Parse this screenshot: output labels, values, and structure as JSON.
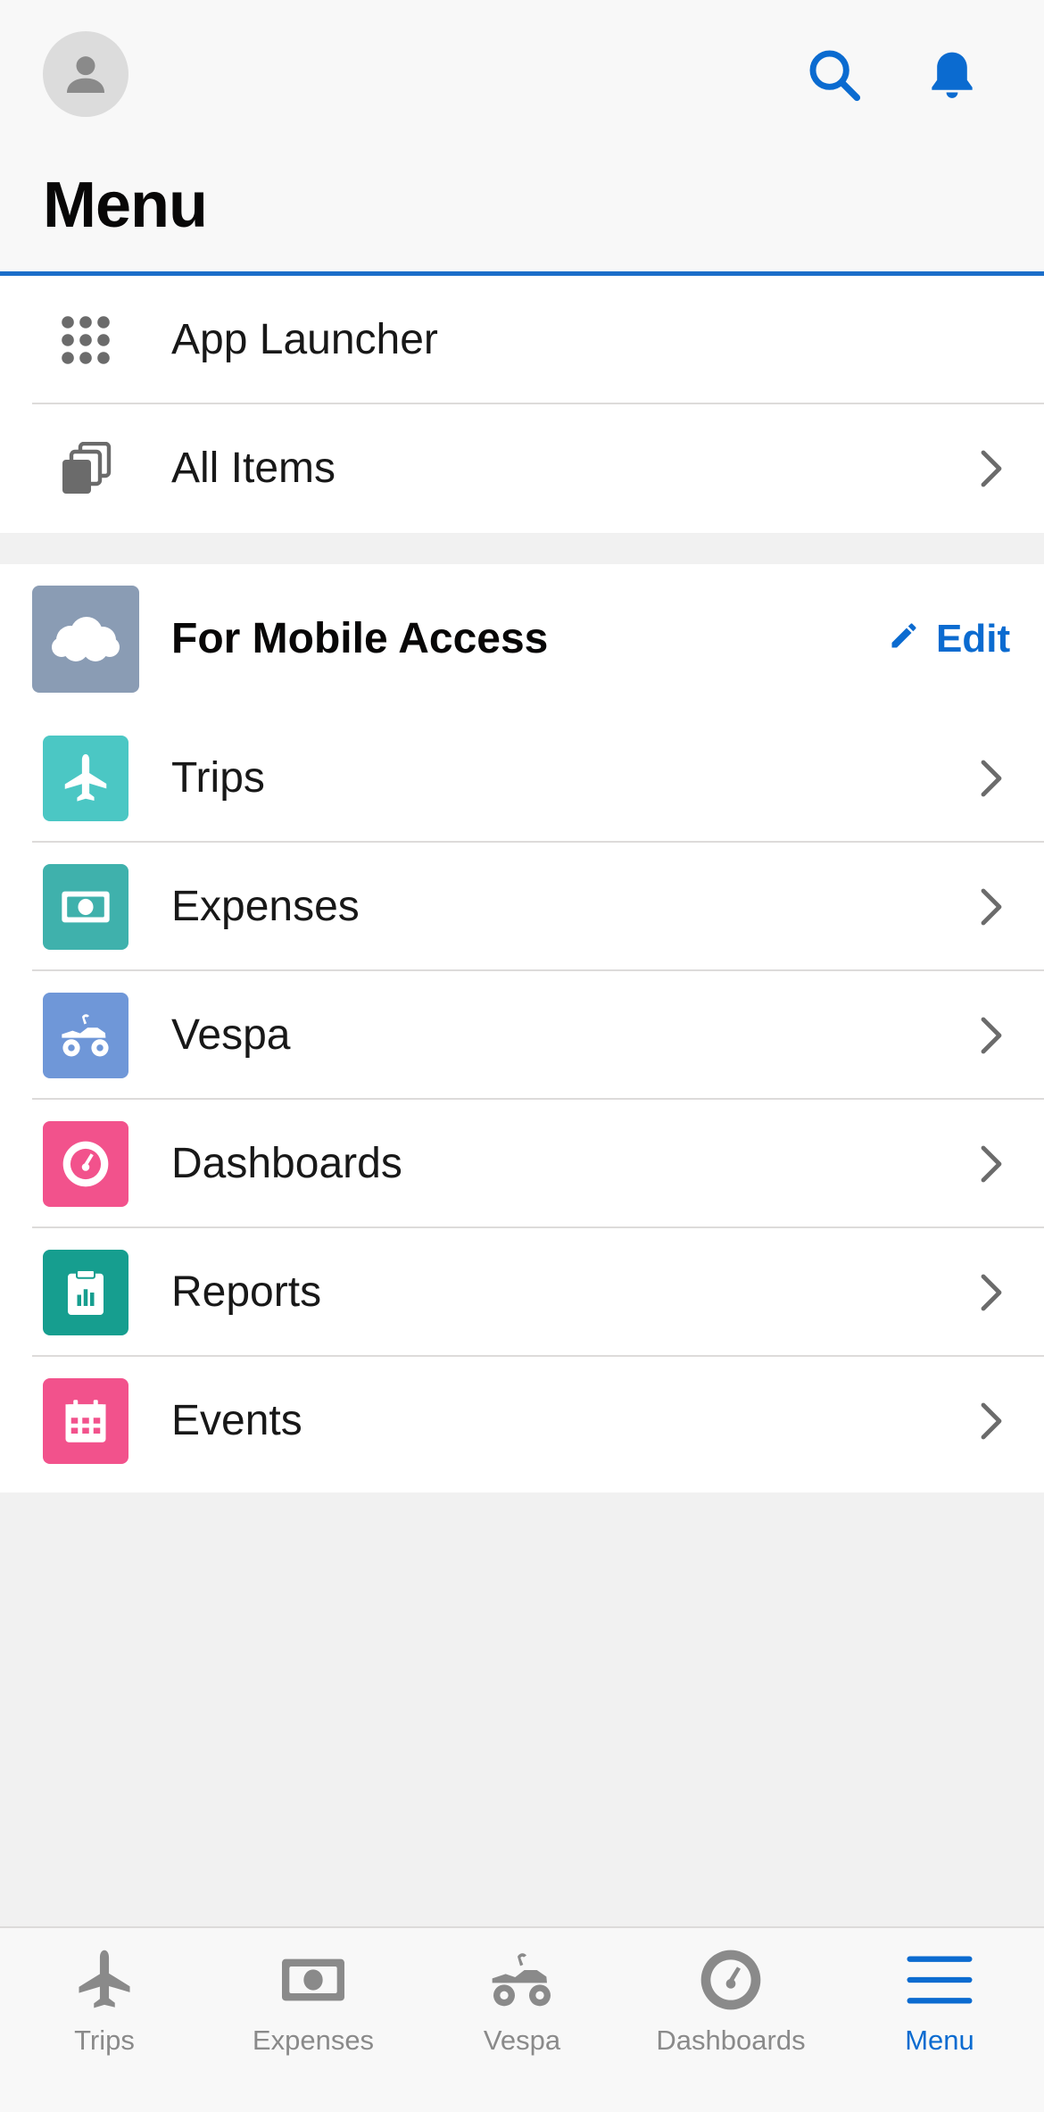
{
  "header": {
    "title": "Menu",
    "avatar_icon": "user-avatar-icon",
    "search_icon": "search-icon",
    "bell_icon": "bell-icon",
    "accent": "#1b6ec9"
  },
  "top_items": [
    {
      "label": "App Launcher",
      "icon": "app-launcher-grid-icon",
      "chevron": false
    },
    {
      "label": "All Items",
      "icon": "stacked-pages-icon",
      "chevron": true
    }
  ],
  "section": {
    "title": "For Mobile Access",
    "logo_icon": "cloud-icon",
    "edit_label": "Edit",
    "edit_icon": "pencil-icon",
    "items": [
      {
        "label": "Trips",
        "icon": "airplane-icon",
        "color": "#4bc7c4"
      },
      {
        "label": "Expenses",
        "icon": "money-icon",
        "color": "#3fb1ac"
      },
      {
        "label": "Vespa",
        "icon": "atv-icon",
        "color": "#6f97d8"
      },
      {
        "label": "Dashboards",
        "icon": "gauge-icon",
        "color": "#f2528c"
      },
      {
        "label": "Reports",
        "icon": "report-clipboard-icon",
        "color": "#169e8f"
      },
      {
        "label": "Events",
        "icon": "calendar-icon",
        "color": "#f2528c"
      }
    ]
  },
  "tabbar": {
    "active_color": "#0b6bd0",
    "inactive_color": "#8a8a8a",
    "tabs": [
      {
        "label": "Trips",
        "icon": "airplane-icon"
      },
      {
        "label": "Expenses",
        "icon": "money-icon"
      },
      {
        "label": "Vespa",
        "icon": "atv-icon"
      },
      {
        "label": "Dashboards",
        "icon": "gauge-icon"
      },
      {
        "label": "Menu",
        "icon": "hamburger-menu-icon",
        "active": true
      }
    ]
  }
}
